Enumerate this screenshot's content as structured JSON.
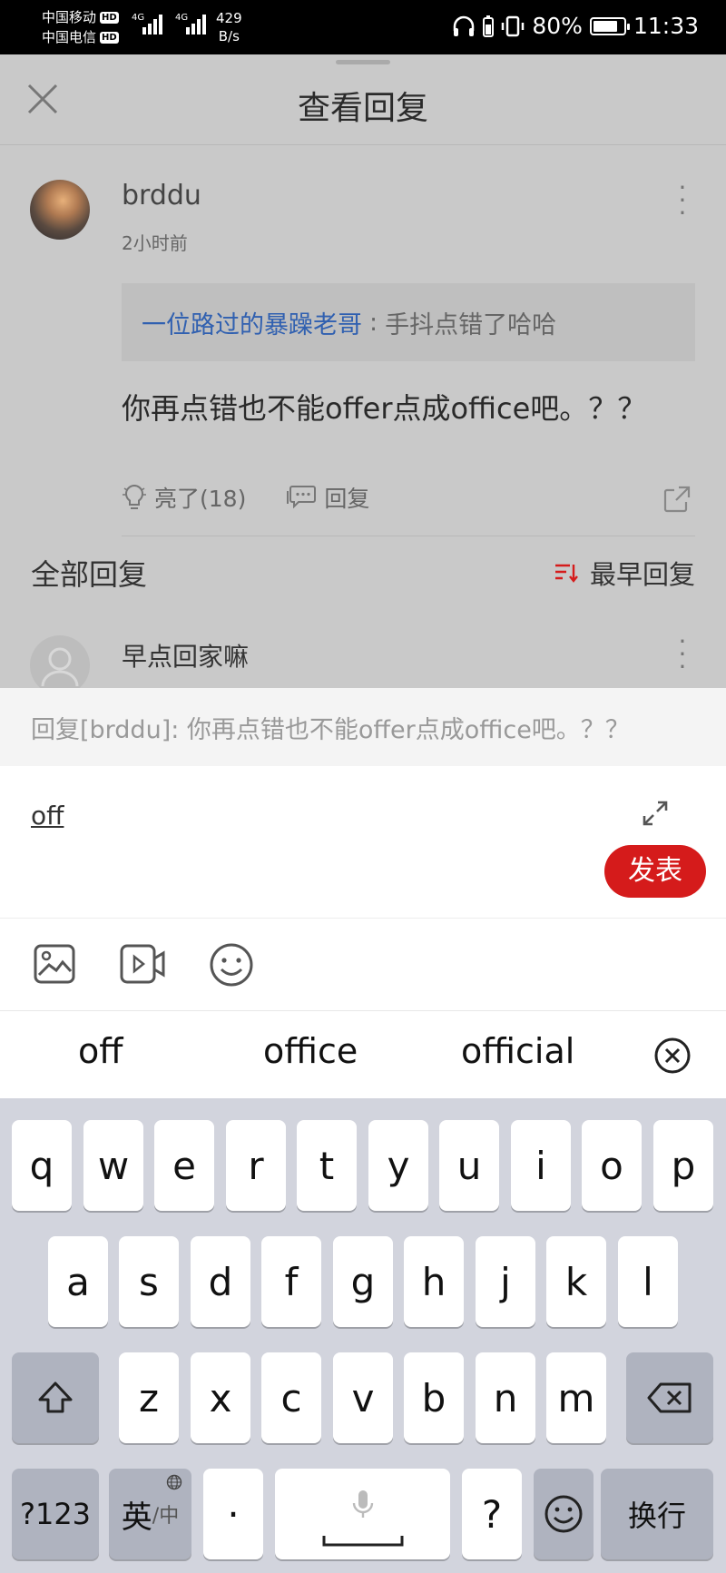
{
  "status_bar": {
    "carrier1": "中国移动",
    "carrier2": "中国电信",
    "hd": "HD",
    "net1": "4G",
    "net2": "4G",
    "speed_value": "429",
    "speed_unit": "B/s",
    "battery": "80%",
    "battery_level": 0.8,
    "time": "11:33"
  },
  "header": {
    "title": "查看回复",
    "close_icon": "close-icon"
  },
  "post": {
    "username": "brddu",
    "time": "2小时前",
    "quote_user": "一位路过的暴躁老哥",
    "quote_sep": ":",
    "quote_text": "手抖点错了哈哈",
    "content": "你再点错也不能offer点成office吧。？？",
    "like_label": "亮了(18)",
    "reply_label": "回复"
  },
  "replies": {
    "header": "全部回复",
    "sort_label": "最早回复",
    "first_reply_name": "早点回家嘛"
  },
  "composer": {
    "reply_target": "回复[brddu]: 你再点错也不能offer点成office吧。？？",
    "typed_text": "off",
    "publish_label": "发表"
  },
  "suggestions": [
    "off",
    "office",
    "official"
  ],
  "keyboard": {
    "row1": [
      "q",
      "w",
      "e",
      "r",
      "t",
      "y",
      "u",
      "i",
      "o",
      "p"
    ],
    "row2": [
      "a",
      "s",
      "d",
      "f",
      "g",
      "h",
      "j",
      "k",
      "l"
    ],
    "row3": [
      "z",
      "x",
      "c",
      "v",
      "b",
      "n",
      "m"
    ],
    "num_key": "?123",
    "lang_main": "英",
    "lang_sub": "/中",
    "dot_key": "·",
    "question_key": "?",
    "enter_key": "换行"
  },
  "colors": {
    "accent_red": "#d51b1b",
    "link_blue": "#3060b0"
  }
}
